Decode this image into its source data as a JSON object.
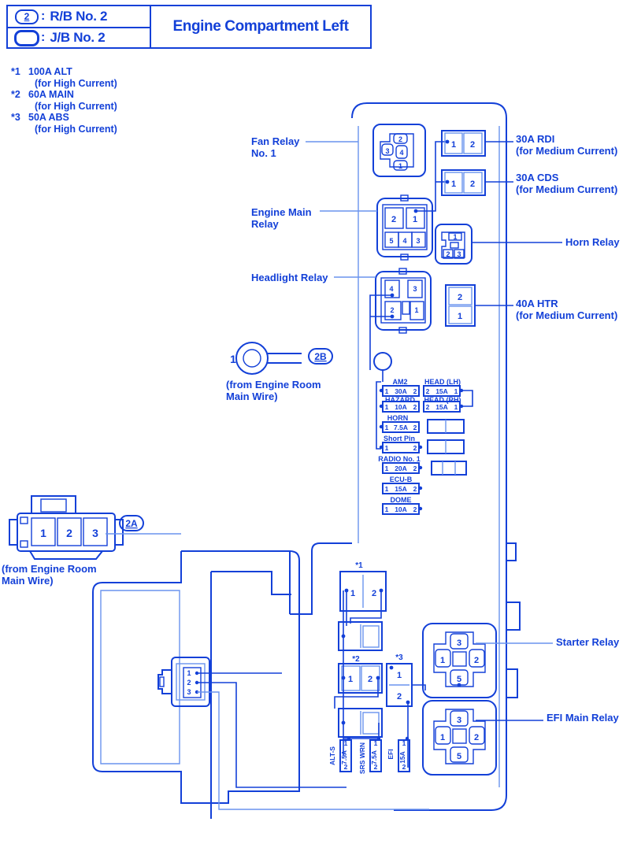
{
  "legend": {
    "rows": [
      {
        "symbol": "circled-2",
        "symbol_text": "2",
        "colon": ":",
        "label": "R/B No. 2"
      },
      {
        "symbol": "oval",
        "symbol_text": "",
        "colon": ":",
        "label": "J/B No. 2"
      }
    ]
  },
  "header": {
    "title": "Engine Compartment Left"
  },
  "footnotes": [
    {
      "mark": "*1",
      "name": "100A ALT",
      "note": "(for High Current)"
    },
    {
      "mark": "*2",
      "name": "60A MAIN",
      "note": "(for High Current)"
    },
    {
      "mark": "*3",
      "name": "50A ABS",
      "note": "(for High Current)"
    }
  ],
  "callouts": {
    "fan_relay": "Fan Relay\nNo. 1",
    "fan_relay_line1": "Fan Relay",
    "fan_relay_line2": "No. 1",
    "engine_main_relay_line1": "Engine Main",
    "engine_main_relay_line2": "Relay",
    "headlight_relay": "Headlight Relay",
    "rdi_line1": "30A RDI",
    "rdi_line2": "(for Medium Current)",
    "cds_line1": "30A CDS",
    "cds_line2": "(for Medium Current)",
    "horn_relay": "Horn Relay",
    "htr_line1": "40A HTR",
    "htr_line2": "(for Medium Current)",
    "starter_relay": "Starter Relay",
    "efi_main_relay": "EFI Main Relay",
    "from_engine_room_top_line1": "(from Engine Room",
    "from_engine_room_top_line2": "Main Wire)",
    "from_engine_room_bot_line1": "(from Engine Room",
    "from_engine_room_bot_line2": "Main Wire)"
  },
  "connectors": {
    "c2a": {
      "tag": "2A",
      "pins": [
        "1",
        "2",
        "3"
      ]
    },
    "c2b": {
      "tag": "2B",
      "pins": [
        "1"
      ]
    }
  },
  "relays": {
    "fan_relay_no1": {
      "name": "Fan Relay No. 1",
      "pins": [
        "1",
        "2",
        "3",
        "4"
      ]
    },
    "engine_main": {
      "name": "Engine Main Relay",
      "pins": [
        "1",
        "2",
        "3",
        "4",
        "5"
      ]
    },
    "headlight": {
      "name": "Headlight Relay",
      "pins": [
        "1",
        "2",
        "3",
        "4"
      ]
    },
    "horn": {
      "name": "Horn Relay",
      "pins": [
        "1",
        "2",
        "3"
      ]
    },
    "starter": {
      "name": "Starter Relay",
      "pins": [
        "1",
        "2",
        "3",
        "5"
      ]
    },
    "efi_main": {
      "name": "EFI Main Relay",
      "pins": [
        "1",
        "2",
        "3",
        "5"
      ]
    }
  },
  "high_current_fuses": {
    "rdi": {
      "label": "30A RDI",
      "rating": "30A",
      "note": "(for Medium Current)",
      "pins": [
        "1",
        "2"
      ]
    },
    "cds": {
      "label": "30A CDS",
      "rating": "30A",
      "note": "(for Medium Current)",
      "pins": [
        "1",
        "2"
      ]
    },
    "htr": {
      "label": "40A HTR",
      "rating": "40A",
      "note": "(for Medium Current)",
      "pins": [
        "2",
        "1"
      ]
    },
    "alt": {
      "mark": "*1",
      "label": "100A ALT",
      "pins": [
        "1",
        "2"
      ]
    },
    "main": {
      "mark": "*2",
      "label": "60A MAIN",
      "pins": [
        "1",
        "2"
      ]
    },
    "abs": {
      "mark": "*3",
      "label": "50A ABS",
      "pins": [
        "1",
        "2"
      ]
    }
  },
  "fuse_block": {
    "columns": [
      "left",
      "right"
    ],
    "rows": [
      {
        "left": {
          "name": "AM2",
          "rating": "30A",
          "pin_left": "1",
          "pin_right": "2"
        },
        "right": {
          "name": "HEAD (LH)",
          "rating": "15A",
          "pin_left": "2",
          "pin_right": "1"
        }
      },
      {
        "left": {
          "name": "HAZARD",
          "rating": "10A",
          "pin_left": "1",
          "pin_right": "2"
        },
        "right": {
          "name": "HEAD (RH)",
          "rating": "15A",
          "pin_left": "2",
          "pin_right": "1"
        }
      },
      {
        "left": {
          "name": "HORN",
          "rating": "7.5A",
          "pin_left": "1",
          "pin_right": "2"
        },
        "right": {
          "name": "",
          "rating": "",
          "pin_left": "",
          "pin_right": ""
        }
      },
      {
        "left": {
          "name": "Short Pin",
          "rating": "",
          "pin_left": "1",
          "pin_right": "2"
        },
        "right": {
          "name": "",
          "rating": "",
          "pin_left": "",
          "pin_right": ""
        }
      },
      {
        "left": {
          "name": "RADIO No. 1",
          "rating": "20A",
          "pin_left": "1",
          "pin_right": "2"
        },
        "right": {
          "name": "",
          "rating": "",
          "pin_left": "",
          "pin_right": ""
        }
      },
      {
        "left": {
          "name": "ECU-B",
          "rating": "15A",
          "pin_left": "1",
          "pin_right": "2"
        },
        "right": {
          "name": "",
          "rating": "",
          "pin_left": "",
          "pin_right": ""
        }
      },
      {
        "left": {
          "name": "DOME",
          "rating": "10A",
          "pin_left": "1",
          "pin_right": "2"
        },
        "right": {
          "name": "",
          "rating": "",
          "pin_left": "",
          "pin_right": ""
        }
      }
    ]
  },
  "vertical_fuses": [
    {
      "name": "ALT-S",
      "rating": "7.5A",
      "pin_top": "1",
      "pin_bottom": "2"
    },
    {
      "name": "SRS WRN",
      "rating": "7.5A",
      "pin_top": "1",
      "pin_bottom": "2"
    },
    {
      "name": "EFI",
      "rating": "15A",
      "pin_top": "1",
      "pin_bottom": "2"
    }
  ],
  "jb_connector": {
    "pins": [
      "1",
      "2",
      "3"
    ]
  },
  "colors": {
    "primary": "#1340d8",
    "light": "#6a93ee",
    "background": "#ffffff"
  }
}
